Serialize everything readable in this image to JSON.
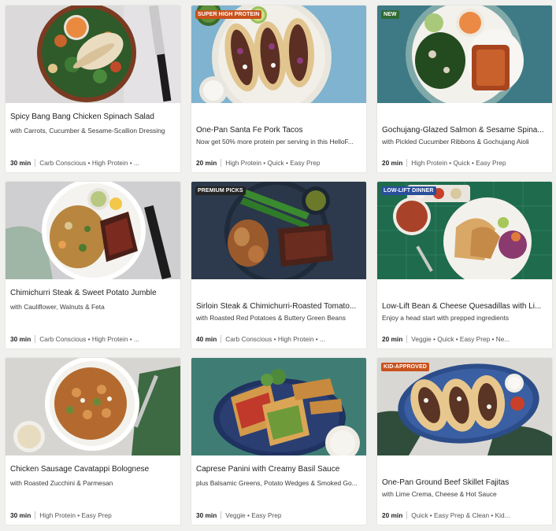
{
  "recipes": [
    {
      "title": "Spicy Bang Bang Chicken Spinach Salad",
      "subtitle": "with Carrots, Cucumber & Sesame-Scallion Dressing",
      "badge": "",
      "time": "30 min",
      "tags": "Carb Conscious • High Protein • ..."
    },
    {
      "title": "One-Pan Santa Fe Pork Tacos",
      "subtitle": "Now get 50% more protein per serving in this HelloF...",
      "badge": "SUPER HIGH PROTEIN",
      "badge_color": "#c8521c",
      "time": "20 min",
      "tags": "High Protein • Quick • Easy Prep"
    },
    {
      "title": "Gochujang-Glazed Salmon & Sesame Spina...",
      "subtitle": "with Pickled Cucumber Ribbons & Gochujang Aioli",
      "badge": "NEW",
      "badge_color": "#2f6a34",
      "time": "20 min",
      "tags": "High Protein • Quick • Easy Prep"
    },
    {
      "title": "Chimichurri Steak & Sweet Potato Jumble",
      "subtitle": "with Cauliflower, Walnuts & Feta",
      "badge": "",
      "time": "30 min",
      "tags": "Carb Conscious • High Protein • ..."
    },
    {
      "title": "Sirloin Steak & Chimichurri-Roasted Tomato...",
      "subtitle": "with Roasted Red Potatoes & Buttery Green Beans",
      "badge": "PREMIUM PICKS",
      "badge_color": "#242424",
      "time": "40 min",
      "tags": "Carb Conscious • High Protein • ..."
    },
    {
      "title": "Low-Lift Bean & Cheese Quesadillas with Li...",
      "subtitle": "Enjoy a head start with prepped ingredients",
      "badge": "LOW-LIFT DINNER",
      "badge_color": "#2a4f9c",
      "time": "20 min",
      "tags": "Veggie • Quick • Easy Prep • Ne..."
    },
    {
      "title": "Chicken Sausage Cavatappi Bolognese",
      "subtitle": "with Roasted Zucchini & Parmesan",
      "badge": "",
      "time": "30 min",
      "tags": "High Protein • Easy Prep"
    },
    {
      "title": "Caprese Panini with Creamy Basil Sauce",
      "subtitle": "plus Balsamic Greens, Potato Wedges & Smoked Go...",
      "badge": "",
      "time": "30 min",
      "tags": "Veggie • Easy Prep"
    },
    {
      "title": "One-Pan Ground Beef Skillet Fajitas",
      "subtitle": "with Lime Crema, Cheese & Hot Sauce",
      "badge": "KID-APPROVED",
      "badge_color": "#c8521c",
      "time": "20 min",
      "tags": "Quick • Easy Prep & Clean • Kid..."
    }
  ],
  "colors": {
    "card_bg": "#ffffff",
    "page_bg": "#f0f0ee"
  }
}
